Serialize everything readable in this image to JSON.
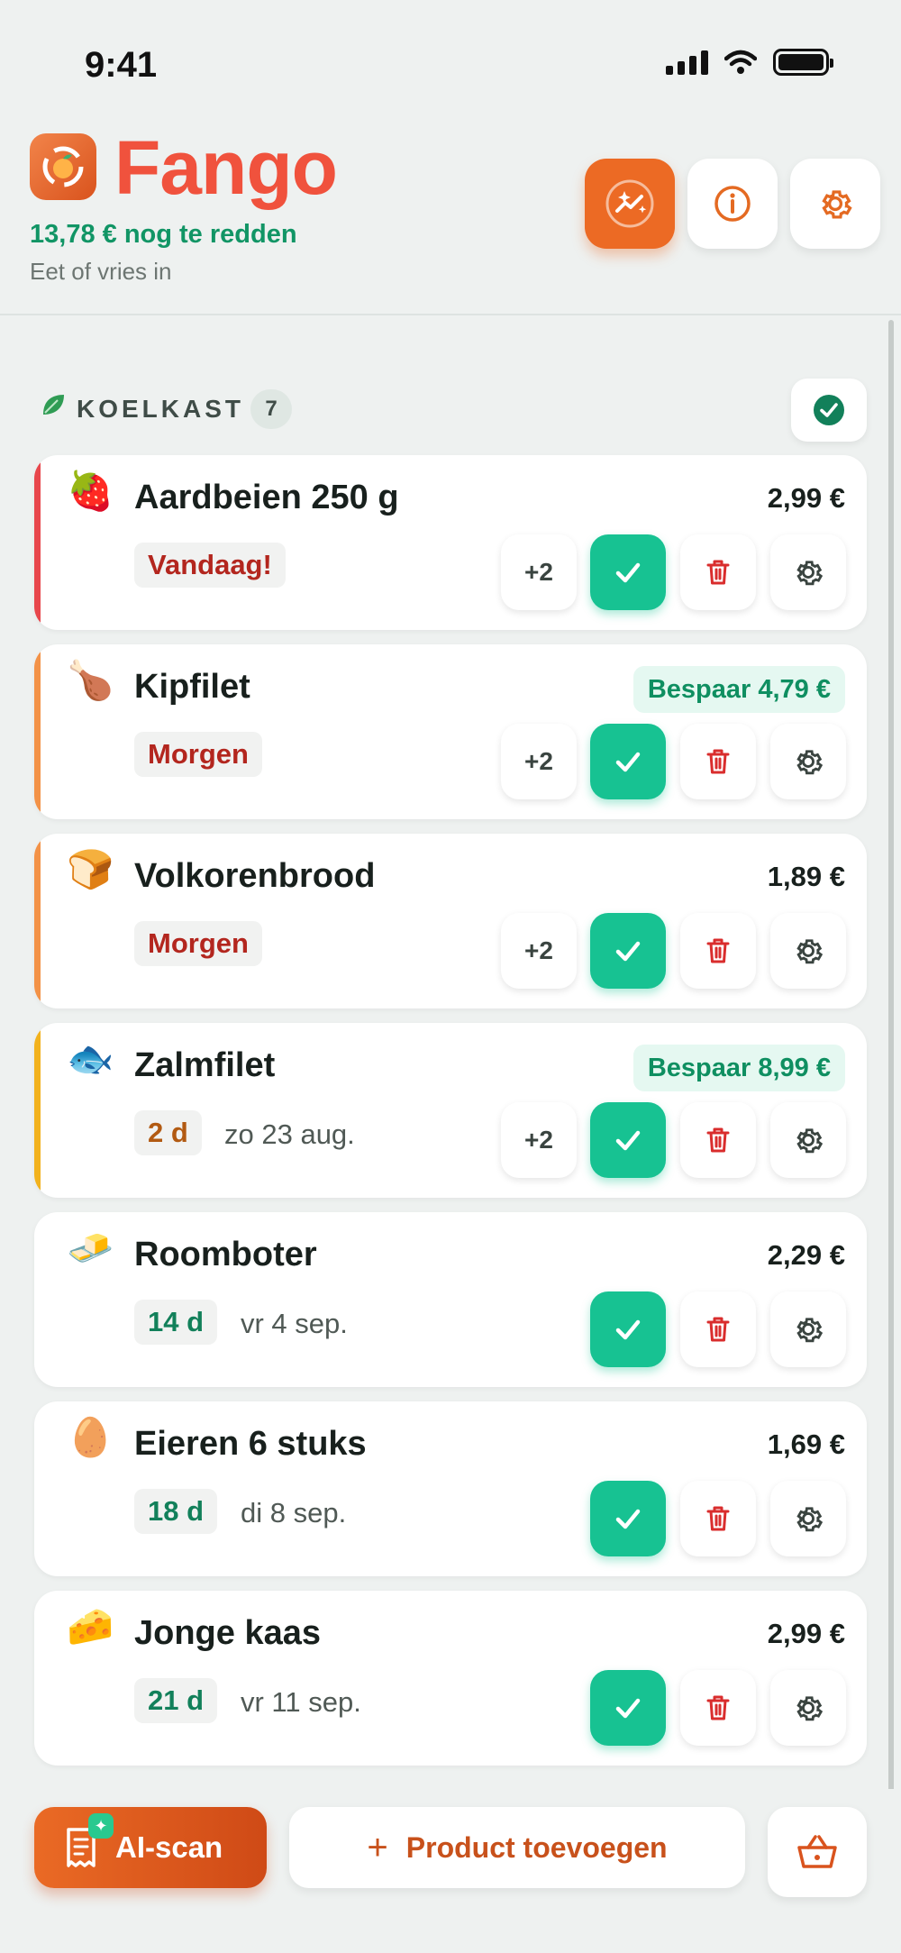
{
  "status_bar": {
    "time": "9:41"
  },
  "header": {
    "app_name": "Fango",
    "savings_text": "13,78 € nog te redden",
    "subtitle": "Eet of vries in",
    "icons": [
      "trend-sparkle-icon",
      "info-icon",
      "gear-icon"
    ]
  },
  "section": {
    "title": "KOELKAST",
    "count": "7",
    "icon": "leaf-icon"
  },
  "products": [
    {
      "emoji": "🍓",
      "name": "Aardbeien 250 g",
      "price": "2,99 €",
      "due": "Vandaag!",
      "due_color": "#b3261e",
      "stripe": "#e8474c",
      "date": "",
      "save": "",
      "plus": "+2"
    },
    {
      "emoji": "🍗",
      "name": "Kipfilet",
      "price": "",
      "due": "Morgen",
      "due_color": "#b3261e",
      "stripe": "#f39247",
      "date": "",
      "save": "Bespaar 4,79 €",
      "plus": "+2"
    },
    {
      "emoji": "🍞",
      "name": "Volkorenbrood",
      "price": "1,89 €",
      "due": "Morgen",
      "due_color": "#b3261e",
      "stripe": "#f39247",
      "date": "",
      "save": "",
      "plus": "+2"
    },
    {
      "emoji": "🐟",
      "name": "Zalmfilet",
      "price": "",
      "due": "2 d",
      "due_color": "#b25a12",
      "stripe": "#f2b21d",
      "date": "zo 23 aug.",
      "save": "Bespaar 8,99 €",
      "plus": "+2"
    },
    {
      "emoji": "🧈",
      "name": "Roomboter",
      "price": "2,29 €",
      "due": "14 d",
      "due_color": "#12805a",
      "stripe": "",
      "date": "vr 4 sep.",
      "save": "",
      "plus": ""
    },
    {
      "emoji": "🥚",
      "name": "Eieren 6 stuks",
      "price": "1,69 €",
      "due": "18 d",
      "due_color": "#12805a",
      "stripe": "",
      "date": "di 8 sep.",
      "save": "",
      "plus": ""
    },
    {
      "emoji": "🧀",
      "name": "Jonge kaas",
      "price": "2,99 €",
      "due": "21 d",
      "due_color": "#12805a",
      "stripe": "",
      "date": "vr 11 sep.",
      "save": "",
      "plus": ""
    }
  ],
  "bottom": {
    "ai_scan_label": "AI-scan",
    "add_product_label": "Product toevoegen",
    "add_icon": "+",
    "basket_icon": "basket-icon"
  },
  "colors": {
    "accent": "#ec6a24",
    "brand": "#f0523d",
    "success": "#17c292",
    "danger": "#d92d2d"
  }
}
